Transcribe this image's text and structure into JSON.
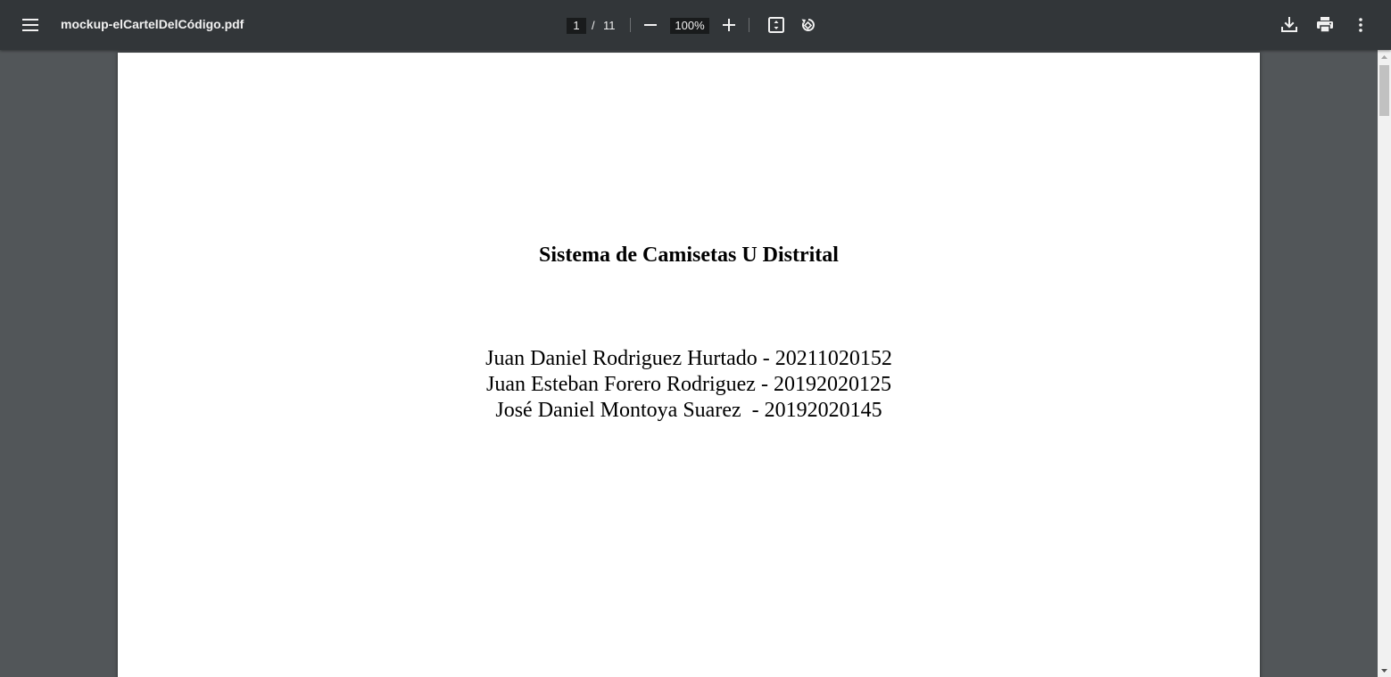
{
  "toolbar": {
    "file_name": "mockup-elCartelDelCódigo.pdf",
    "current_page": "1",
    "page_separator": "/",
    "total_pages": "11",
    "zoom": "100%",
    "icons": {
      "menu": "menu-icon",
      "zoom_out": "minus-icon",
      "zoom_in": "plus-icon",
      "fit": "fit-to-page-icon",
      "rotate": "rotate-counterclockwise-icon",
      "download": "download-icon",
      "print": "print-icon",
      "more": "more-vertical-icon"
    }
  },
  "document": {
    "title": "Sistema de Camisetas U Distrital",
    "authors": [
      "Juan Daniel Rodriguez Hurtado - 20211020152",
      "Juan Esteban Forero Rodriguez - 20192020125",
      "José Daniel Montoya Suarez  - 20192020145"
    ]
  },
  "colors": {
    "toolbar_bg": "#323639",
    "viewer_bg": "#525659",
    "page_bg": "#ffffff",
    "text": "#f1f1f1"
  }
}
